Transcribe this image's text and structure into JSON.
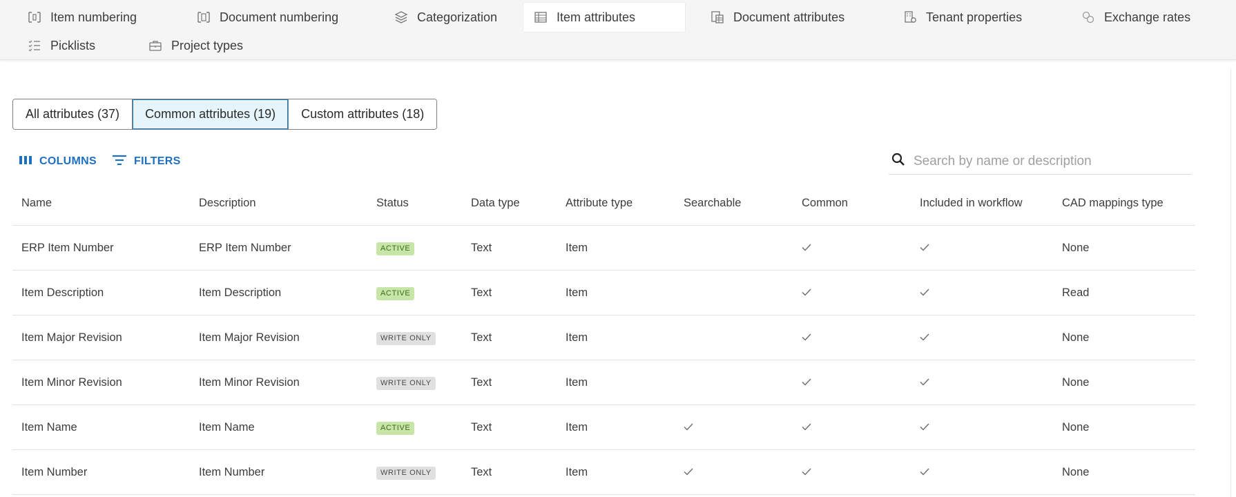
{
  "tabs": {
    "row1": [
      {
        "label": "Item numbering",
        "icon": "numbering-icon"
      },
      {
        "label": "Document numbering",
        "icon": "document-numbering-icon"
      },
      {
        "label": "Categorization",
        "icon": "layers-icon"
      },
      {
        "label": "Item attributes",
        "icon": "table-icon"
      },
      {
        "label": "Document attributes",
        "icon": "document-table-icon"
      },
      {
        "label": "Tenant properties",
        "icon": "tenant-settings-icon"
      },
      {
        "label": "Exchange rates",
        "icon": "exchange-icon"
      }
    ],
    "row2": [
      {
        "label": "Picklists",
        "icon": "checklist-icon"
      },
      {
        "label": "Project types",
        "icon": "briefcase-icon"
      }
    ],
    "active": "Item attributes"
  },
  "filter": {
    "all": "All attributes (37)",
    "common": "Common attributes (19)",
    "custom": "Custom attributes (18)",
    "selected": "common"
  },
  "toolbar": {
    "columns_label": "COLUMNS",
    "filters_label": "FILTERS"
  },
  "search": {
    "placeholder": "Search by name or description",
    "value": ""
  },
  "table": {
    "headers": [
      "Name",
      "Description",
      "Status",
      "Data type",
      "Attribute type",
      "Searchable",
      "Common",
      "Included in workflow",
      "CAD mappings type"
    ],
    "rows": [
      {
        "name": "ERP Item Number",
        "description": "ERP Item Number",
        "status": "ACTIVE",
        "data_type": "Text",
        "attribute_type": "Item",
        "searchable": false,
        "common": true,
        "workflow": true,
        "cad": "None"
      },
      {
        "name": "Item Description",
        "description": "Item Description",
        "status": "ACTIVE",
        "data_type": "Text",
        "attribute_type": "Item",
        "searchable": false,
        "common": true,
        "workflow": true,
        "cad": "Read"
      },
      {
        "name": "Item Major Revision",
        "description": "Item Major Revision",
        "status": "WRITE ONLY",
        "data_type": "Text",
        "attribute_type": "Item",
        "searchable": false,
        "common": true,
        "workflow": true,
        "cad": "None"
      },
      {
        "name": "Item Minor Revision",
        "description": "Item Minor Revision",
        "status": "WRITE ONLY",
        "data_type": "Text",
        "attribute_type": "Item",
        "searchable": false,
        "common": true,
        "workflow": true,
        "cad": "None"
      },
      {
        "name": "Item Name",
        "description": "Item Name",
        "status": "ACTIVE",
        "data_type": "Text",
        "attribute_type": "Item",
        "searchable": true,
        "common": true,
        "workflow": true,
        "cad": "None"
      },
      {
        "name": "Item Number",
        "description": "Item Number",
        "status": "WRITE ONLY",
        "data_type": "Text",
        "attribute_type": "Item",
        "searchable": true,
        "common": true,
        "workflow": true,
        "cad": "None"
      }
    ]
  },
  "colors": {
    "accent": "#1f6fbf",
    "active_badge_bg": "#c6e5a6",
    "write_badge_bg": "#e0e0e0",
    "selected_segment_bg": "#e6f5fc"
  }
}
